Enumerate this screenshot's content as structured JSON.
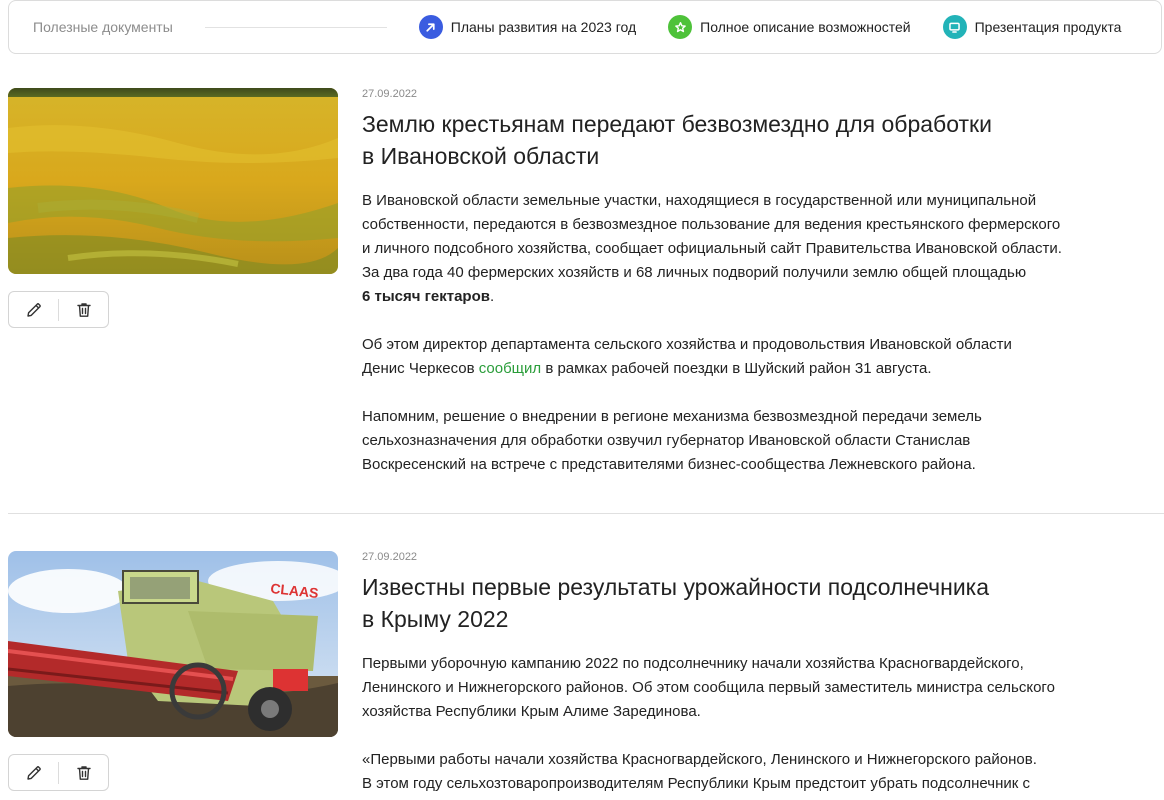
{
  "docs": {
    "title": "Полезные документы",
    "links": [
      {
        "label": "Планы развития на 2023 год",
        "color": "#3a5ce0",
        "icon": "arrow-up-right-icon"
      },
      {
        "label": "Полное описание возможностей",
        "color": "#4ec23a",
        "icon": "star-icon"
      },
      {
        "label": "Презентация продукта",
        "color": "#22b3b8",
        "icon": "monitor-icon"
      }
    ]
  },
  "articles": [
    {
      "date": "27.09.2022",
      "title_line1": "Землю крестьянам передают безвозмездно для обработки",
      "title_line2": "в Ивановской области",
      "p1_lines": [
        "В Ивановской области земельные участки, находящиеся в государственной или муниципальной",
        "собственности, передаются в безвозмездное пользование для ведения крестьянского фермерского",
        "и личного подсобного хозяйства, сообщает официальный сайт Правительства Ивановской области.",
        "За два года 40 фермерских хозяйств и 68 личных подворий получили землю общей площадью"
      ],
      "p1_bold": "6 тысяч гектаров",
      "p1_end": ".",
      "p2_line1": "Об этом директор департамента сельского хозяйства и продовольствия Ивановской области",
      "p2_pre": "Денис Черкесов ",
      "p2_link": "сообщил",
      "p2_post": " в рамках рабочей поездки в Шуйский район 31 августа.",
      "p3_lines": [
        "Напомним, решение о внедрении в регионе механизма безвозмездной передачи земель",
        "сельхозназначения для обработки озвучил губернатор Ивановской области Станислав",
        "Воскресенский на встрече с представителями бизнес-сообщества Лежневского района."
      ]
    },
    {
      "date": "27.09.2022",
      "title_line1": "Известны первые результаты урожайности подсолнечника",
      "title_line2": "в Крыму 2022",
      "p1_lines": [
        "Первыми уборочную кампанию 2022 по подсолнечнику начали хозяйства Красногвардейского,",
        "Ленинского и Нижнегорского районов. Об этом сообщила первый заместитель министра сельского",
        "хозяйства Республики Крым Алиме Зарединова."
      ],
      "p2_lines": [
        "«Первыми работы начали хозяйства Красногвардейского, Ленинского и Нижнегорского районов.",
        "В этом году сельхозтоваропроизводителям Республики Крым предстоит убрать подсолнечник с"
      ],
      "machine_text": "CLAAS"
    }
  ]
}
